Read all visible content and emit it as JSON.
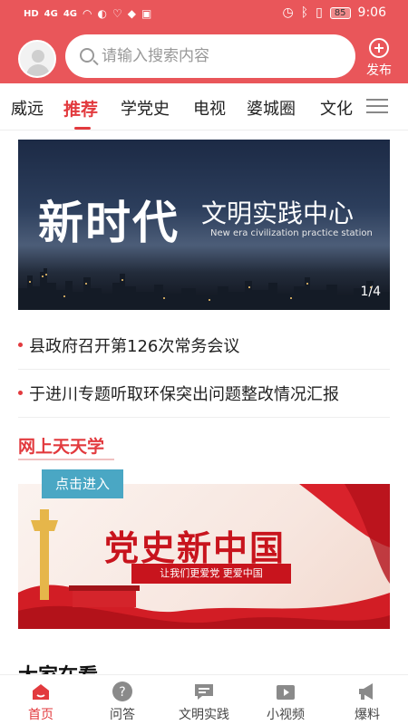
{
  "status_bar": {
    "time": "9:06",
    "battery": "85",
    "signal_left": "4G",
    "signal_right": "4G"
  },
  "header": {
    "search_placeholder": "请输入搜索内容",
    "publish_label": "发布"
  },
  "tabs": [
    "威远",
    "推荐",
    "学党史",
    "电视",
    "婆城圈",
    "文化"
  ],
  "active_tab": "推荐",
  "banner": {
    "title_big": "新时代",
    "title_sub": "文明实践中心",
    "subtitle_en": "New era civilization practice station",
    "pager": "1/4"
  },
  "news": [
    "县政府召开第126次常务会议",
    "于进川专题听取环保突出问题整改情况汇报"
  ],
  "section": {
    "title": "网上天天学",
    "enter_button": "点击进入",
    "promo_title": "党史新中国",
    "promo_sub": "让我们更爱党 更爱中国"
  },
  "next_section_heading": "大家在看",
  "bottom_nav": [
    {
      "label": "首页",
      "icon": "home-icon",
      "active": true
    },
    {
      "label": "问答",
      "icon": "question-icon",
      "active": false
    },
    {
      "label": "文明实践",
      "icon": "chat-icon",
      "active": false
    },
    {
      "label": "小视频",
      "icon": "video-icon",
      "active": false
    },
    {
      "label": "爆料",
      "icon": "megaphone-icon",
      "active": false
    }
  ],
  "colors": {
    "brand": "#e9565a",
    "accent": "#e23a3e",
    "button": "#4aa7c4"
  }
}
